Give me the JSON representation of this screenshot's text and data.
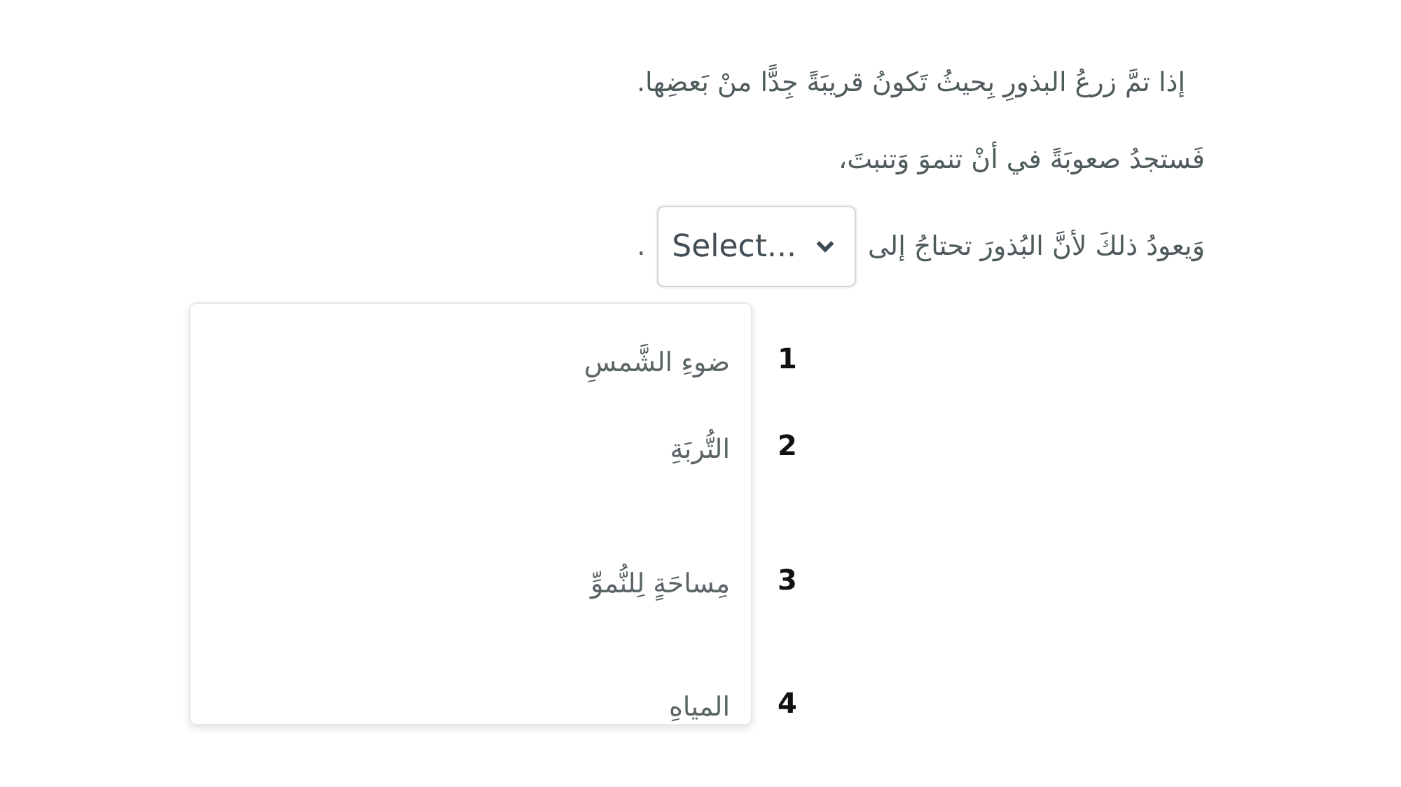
{
  "lines": [
    {
      "text": "إذا تمَّ زرعُ البذورِ بِحيثُ تَكونُ قريبَةً جِدًّا منْ بَعضِها."
    },
    {
      "text": "فَستجدُ صعوبَةً في أنْ تنموَ وَتنبتَ،"
    }
  ],
  "blank_line": {
    "before": "وَيعودُ ذلكَ لأنَّ البُذورَ تحتاجُ إلى",
    "after": ".",
    "select": {
      "placeholder": "Select...",
      "expanded": true,
      "options": [
        {
          "number": "1",
          "label": "ضوءِ الشَّمسِ"
        },
        {
          "number": "2",
          "label": "التُّربَةِ"
        },
        {
          "number": "3",
          "label": "مِساحَةٍ لِلنُّموِّ"
        },
        {
          "number": "4",
          "label": "المياهِ"
        }
      ]
    }
  }
}
